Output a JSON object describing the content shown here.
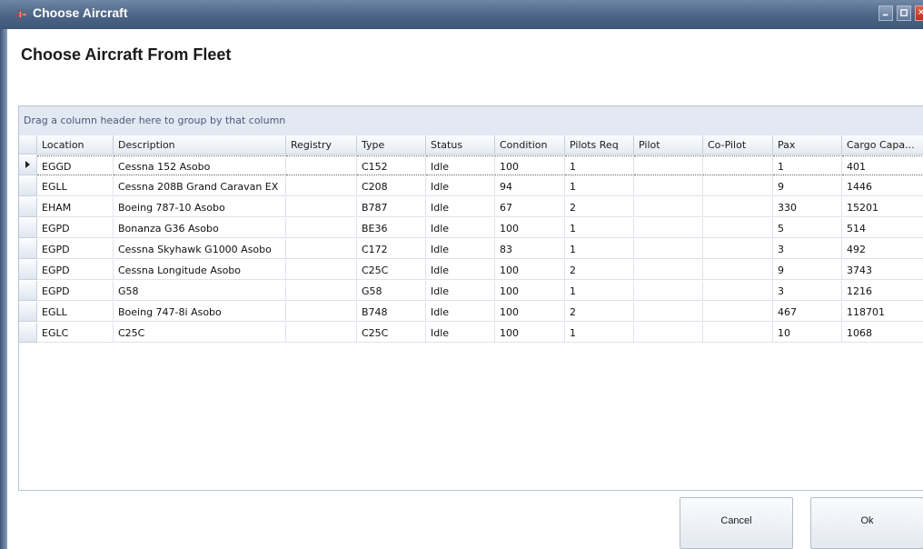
{
  "window": {
    "title": "Choose Aircraft"
  },
  "heading": "Choose Aircraft From Fleet",
  "grid": {
    "group_hint": "Drag a column header here to group by that column",
    "columns": [
      "Location",
      "Description",
      "Registry",
      "Type",
      "Status",
      "Condition",
      "Pilots Req",
      "Pilot",
      "Co-Pilot",
      "Pax",
      "Cargo Capa..."
    ],
    "rows": [
      [
        "EGGD",
        "Cessna 152 Asobo",
        "",
        "C152",
        "Idle",
        "100",
        "1",
        "",
        "",
        "1",
        "401"
      ],
      [
        "EGLL",
        "Cessna 208B Grand Caravan EX",
        "",
        "C208",
        "Idle",
        "94",
        "1",
        "",
        "",
        "9",
        "1446"
      ],
      [
        "EHAM",
        "Boeing 787-10 Asobo",
        "",
        "B787",
        "Idle",
        "67",
        "2",
        "",
        "",
        "330",
        "15201"
      ],
      [
        "EGPD",
        "Bonanza G36 Asobo",
        "",
        "BE36",
        "Idle",
        "100",
        "1",
        "",
        "",
        "5",
        "514"
      ],
      [
        "EGPD",
        "Cessna Skyhawk G1000 Asobo",
        "",
        "C172",
        "Idle",
        "83",
        "1",
        "",
        "",
        "3",
        "492"
      ],
      [
        "EGPD",
        "Cessna Longitude Asobo",
        "",
        "C25C",
        "Idle",
        "100",
        "2",
        "",
        "",
        "9",
        "3743"
      ],
      [
        "EGPD",
        "G58",
        "",
        "G58",
        "Idle",
        "100",
        "1",
        "",
        "",
        "3",
        "1216"
      ],
      [
        "EGLL",
        "Boeing 747-8i Asobo",
        "",
        "B748",
        "Idle",
        "100",
        "2",
        "",
        "",
        "467",
        "118701"
      ],
      [
        "EGLC",
        "C25C",
        "",
        "C25C",
        "Idle",
        "100",
        "1",
        "",
        "",
        "10",
        "1068"
      ]
    ],
    "selected_row": 0
  },
  "buttons": {
    "cancel": "Cancel",
    "ok": "Ok"
  },
  "colors": {
    "titlebar": "#4c6485",
    "accent": "#b9c4d3"
  },
  "icons": {
    "app": "aircraft-icon",
    "minimize": "minimize-icon",
    "maximize": "maximize-icon",
    "close": "close-icon"
  }
}
